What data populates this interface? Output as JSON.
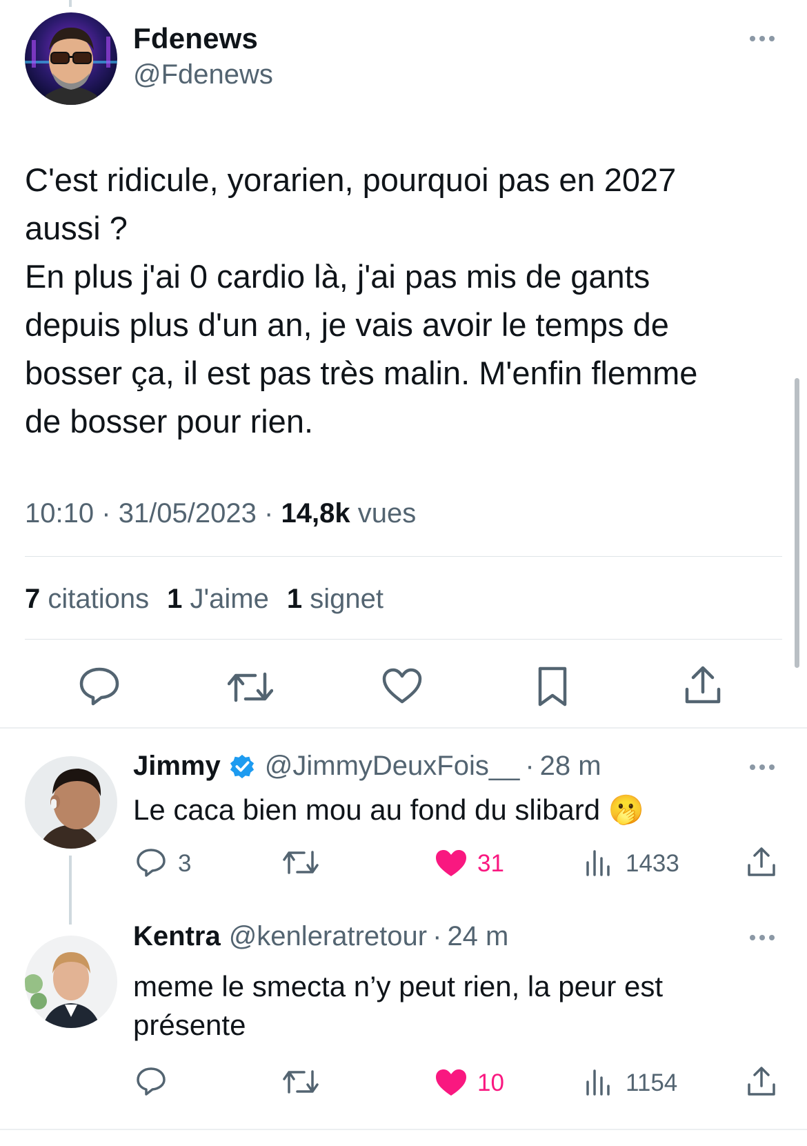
{
  "main_tweet": {
    "author_name": "Fdenews",
    "author_handle": "@Fdenews",
    "text": "C'est ridicule, yorarien, pourquoi pas en 2027\naussi ?\nEn plus j'ai 0 cardio là, j'ai pas mis de gants\ndepuis plus d'un an, je vais avoir le temps de\nbosser ça, il est pas très malin. M'enfin flemme\nde bosser pour rien.",
    "time": "10:10",
    "date": "31/05/2023",
    "separator": "·",
    "views_count": "14,8k",
    "views_label": "vues",
    "quotes_count": "7",
    "quotes_label": "citations",
    "likes_count": "1",
    "likes_label": "J'aime",
    "bookmarks_count": "1",
    "bookmarks_label": "signet",
    "actions": [
      "reply-icon",
      "retweet-icon",
      "like-icon",
      "bookmark-icon",
      "share-icon"
    ]
  },
  "replies": [
    {
      "author_name": "Jimmy",
      "verified": true,
      "author_handle": "@JimmyDeuxFois__",
      "separator": "·",
      "time": "28 m",
      "text": "Le caca bien mou au fond du slibard 🫢",
      "reply_count": "3",
      "retweet_count": "",
      "like_count": "31",
      "liked": true,
      "view_count": "1433"
    },
    {
      "author_name": "Kentra",
      "verified": false,
      "author_handle": "@kenleratretour",
      "separator": "·",
      "time": "24 m",
      "text": "meme le smecta n’y peut rien, la peur est présente",
      "reply_count": "",
      "retweet_count": "",
      "like_count": "10",
      "liked": true,
      "view_count": "1154"
    }
  ],
  "colors": {
    "text_primary": "#0f1419",
    "text_secondary": "#536471",
    "like_pink": "#f91880",
    "verified_blue": "#1d9bf0",
    "divider": "#dfe4e8"
  }
}
